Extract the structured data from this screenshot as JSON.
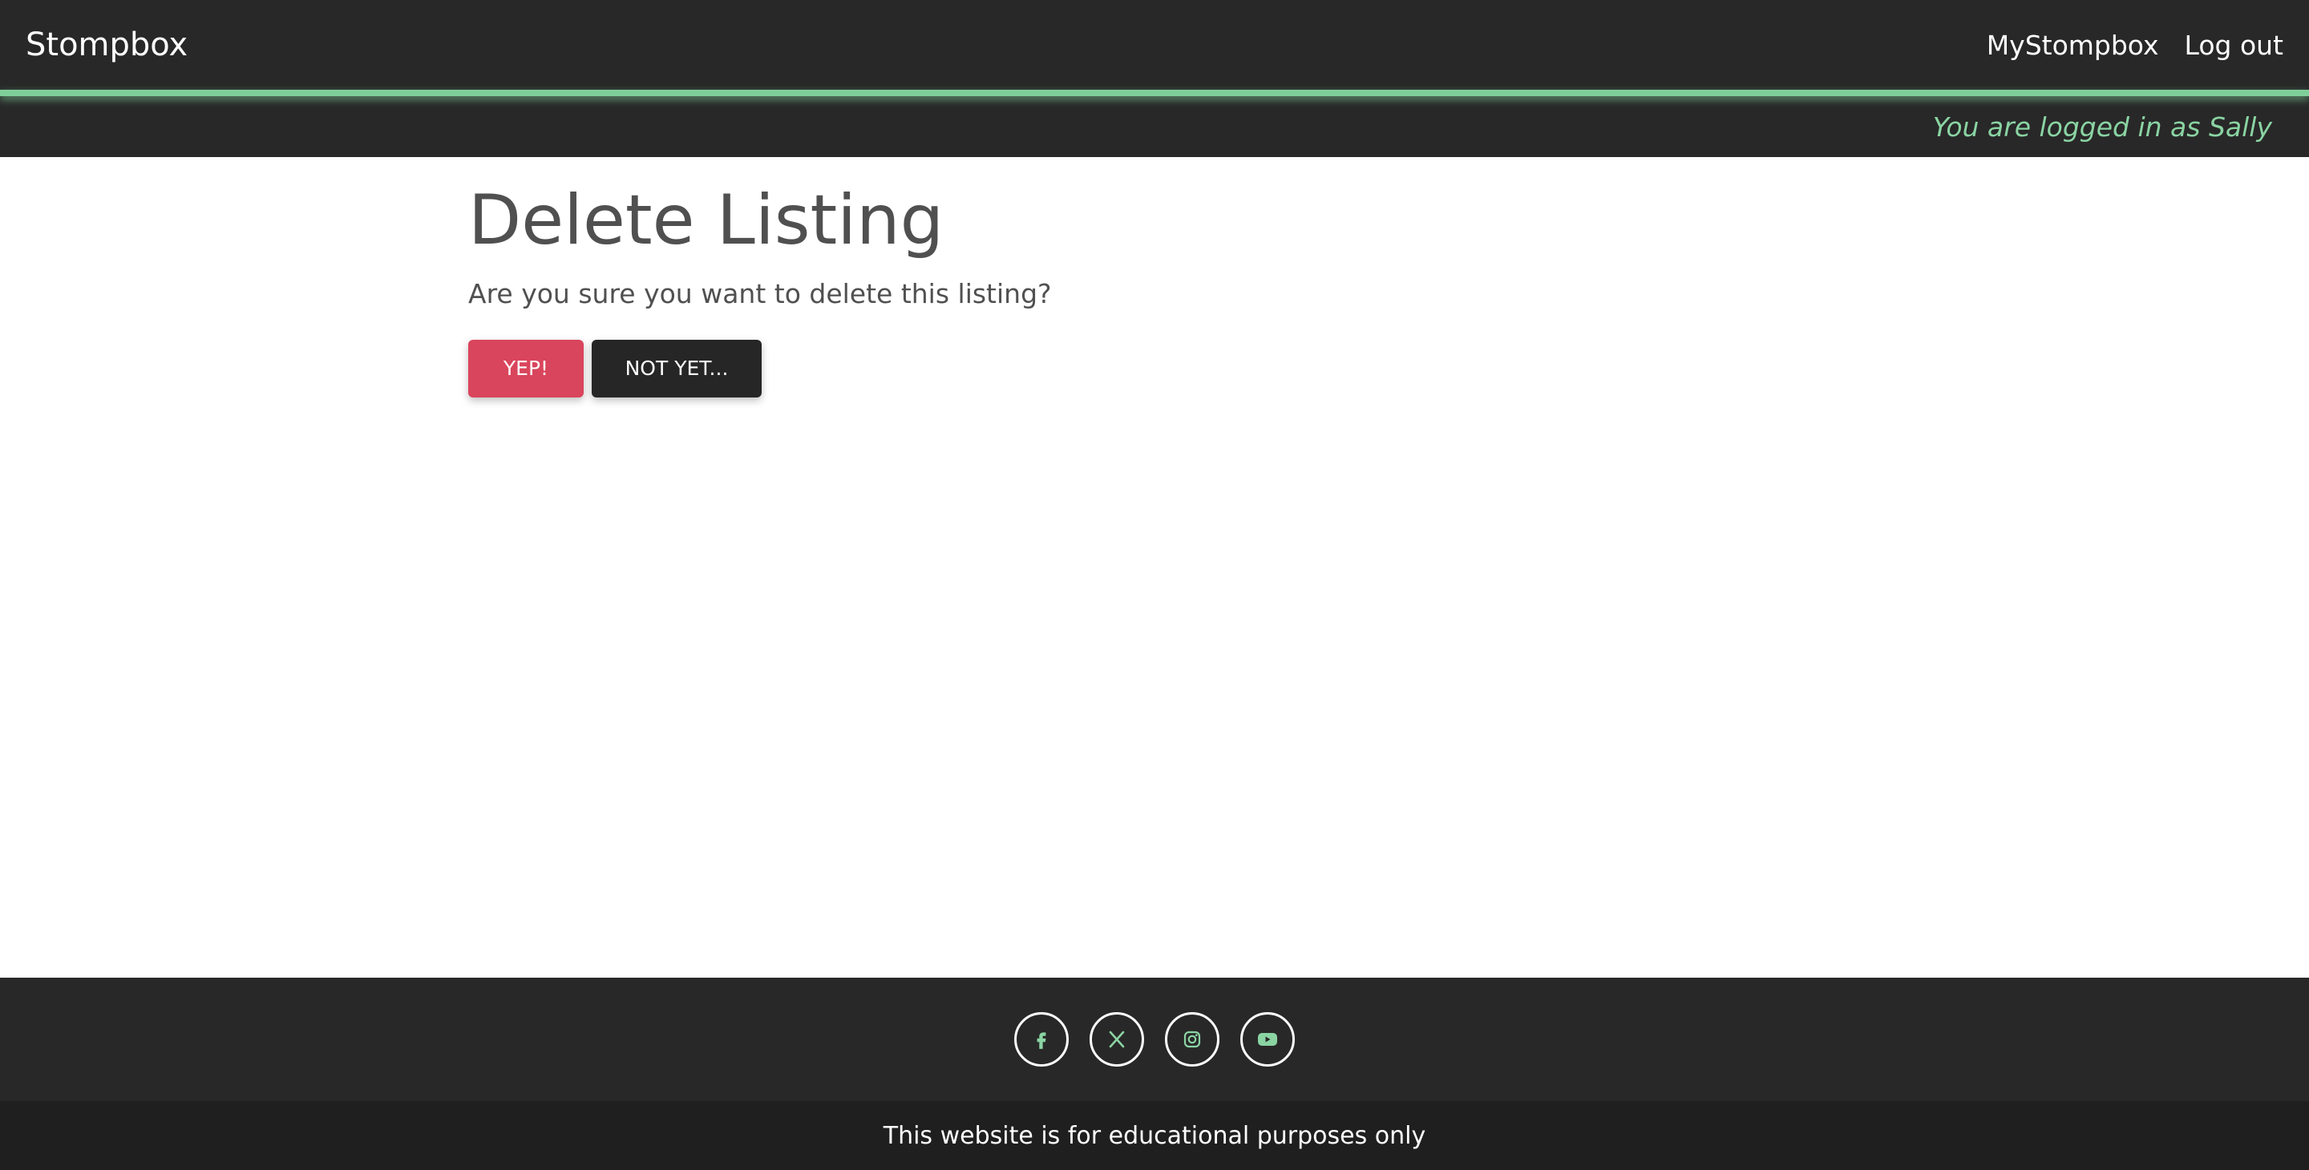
{
  "header": {
    "brand": "Stompbox",
    "nav": {
      "my_stompbox": "MyStompbox",
      "logout": "Log out"
    },
    "status": "You are logged in as Sally"
  },
  "main": {
    "title": "Delete Listing",
    "prompt": "Are you sure you want to delete this listing?",
    "confirm_label": "YEP!",
    "cancel_label": "NOT YET..."
  },
  "footer": {
    "social_icons": [
      "facebook-icon",
      "x-icon",
      "instagram-icon",
      "youtube-icon"
    ],
    "note": "This website is for educational purposes only"
  },
  "colors": {
    "navbar_bg": "#282828",
    "accent": "#7fcf9a",
    "danger": "#d9455c",
    "dark_button": "#262626"
  }
}
